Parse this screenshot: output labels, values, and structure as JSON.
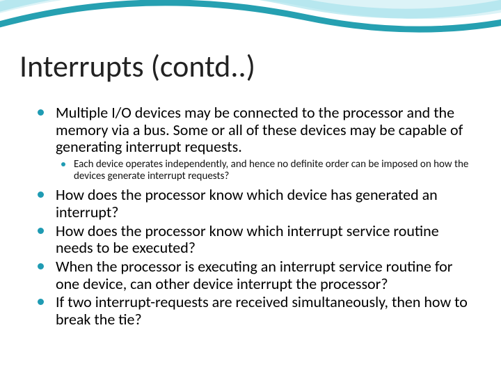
{
  "title": "Interrupts (contd..)",
  "bullets": [
    {
      "text": "Multiple I/O devices may be connected to the processor and the memory via a bus. Some or all of these devices may be capable of generating interrupt requests.",
      "sub": [
        "Each device operates independently, and hence no definite order can be imposed on how the devices generate interrupt requests?"
      ]
    },
    {
      "text": "How does the processor know which device has generated an interrupt?"
    },
    {
      "text": "How does the processor know which interrupt service routine needs to be executed?"
    },
    {
      "text": "When the processor is executing an interrupt service routine for one device, can other device interrupt the processor?"
    },
    {
      "text": "If two interrupt-requests are received simultaneously, then how to break the tie?"
    }
  ],
  "colors": {
    "accent": "#1f9bb3",
    "swoosh_light": "#bfeaf1",
    "swoosh_dark": "#0e96a8"
  }
}
